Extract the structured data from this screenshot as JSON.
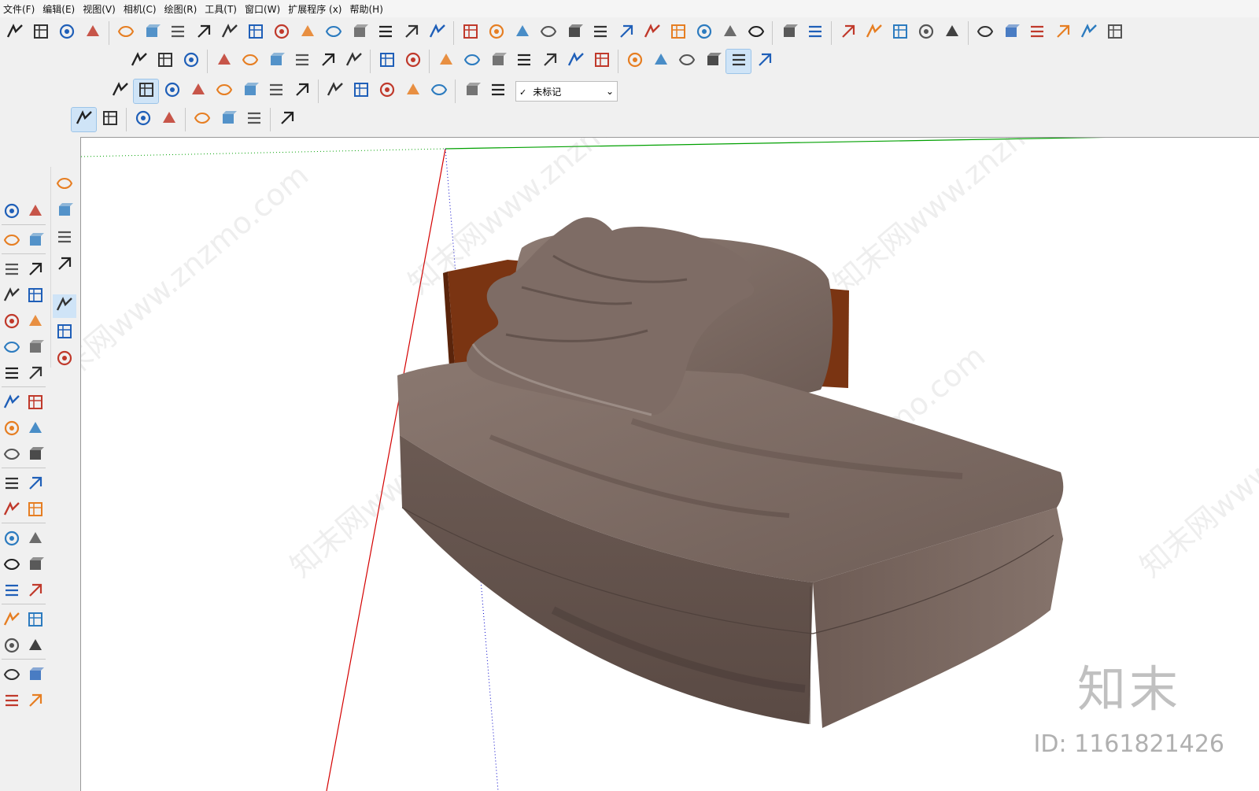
{
  "menu": [
    "文件(F)",
    "编辑(E)",
    "视图(V)",
    "相机(C)",
    "绘图(R)",
    "工具(T)",
    "窗口(W)",
    "扩展程序 (x)",
    "帮助(H)"
  ],
  "tag_dropdown": {
    "check": "✓",
    "value": "未标记"
  },
  "watermark": {
    "text": "知末网www.znzmo.com"
  },
  "brand": {
    "logo": "知末",
    "id": "ID: 1161821426"
  },
  "colors": {
    "sofa_fabric": "#7d6a62",
    "sofa_shadow": "#5e4e48",
    "backboard": "#7a3412",
    "axis_red": "#d40000",
    "axis_green": "#00a000",
    "axis_blue": "#0000c8"
  },
  "toolbar_icons": {
    "row1": [
      "follow-me-icon",
      "section-icon",
      "stairs-icon",
      "bar-chart-icon",
      "sandbox-icon",
      "line-join-icon",
      "arrow-split-icon",
      "star-tool-icon",
      "arch-icon",
      "rotate-loop-icon",
      "figure-icon",
      "bench-icon",
      "spiral-icon",
      "layers-icon",
      "stack-icon",
      "window-icon",
      "layers-alt-icon",
      "arc-cap-icon",
      "chain-icon",
      "wave-icon",
      "spiral-coil-icon",
      "hatch-icon",
      "fence-icon",
      "columns-icon",
      "mirror-icon",
      "dot-grid-icon",
      "panel-icon",
      "compass-icon",
      "broom-icon",
      "target-icon",
      "capture-icon",
      "folder-export-icon",
      "checkbox-icon",
      "cloud-upload-icon",
      "cube-rotate-icon",
      "refresh-blue-icon",
      "house-3d-icon",
      "door-icon",
      "home-icon",
      "shed-icon",
      "house-outline-icon",
      "garage-icon"
    ],
    "row2": [
      "ruler-icon",
      "dimension-icon",
      "path-curve-icon",
      "eraser-bar-icon",
      "frame-box-icon",
      "cylinder-icon",
      "skew-box-icon",
      "tape-icon",
      "cross-cut-icon",
      "ribbon-icon",
      "scale-box-icon",
      "scale-box-alt-icon",
      "solid-union-icon",
      "solid-subtract-icon",
      "solid-intersect-icon",
      "solid-trim-icon",
      "solid-split-icon",
      "solid-outer-icon",
      "wire-cube-icon",
      "face-style-icon",
      "shaded-box-icon",
      "textured-box-icon",
      "stacked-layers-icon",
      "blue-cube-icon"
    ],
    "row3": [
      "play-icon",
      "pause-icon",
      "record-icon",
      "stop-icon",
      "settings-gear-icon",
      "film-icon",
      "film-delete-icon",
      "help-icon",
      "purple-badge-icon",
      "refresh-gray-icon",
      "video-camera-icon",
      "camera-icon",
      "timer-icon",
      "flower-icon",
      "package-icon"
    ],
    "row4": [
      "cloud-sync-icon",
      "cloud-network-icon",
      "cloud-check-icon",
      "cloud-list-icon",
      "resize-icon",
      "nodes-icon",
      "check-circle-icon",
      "chrome-icon"
    ]
  }
}
